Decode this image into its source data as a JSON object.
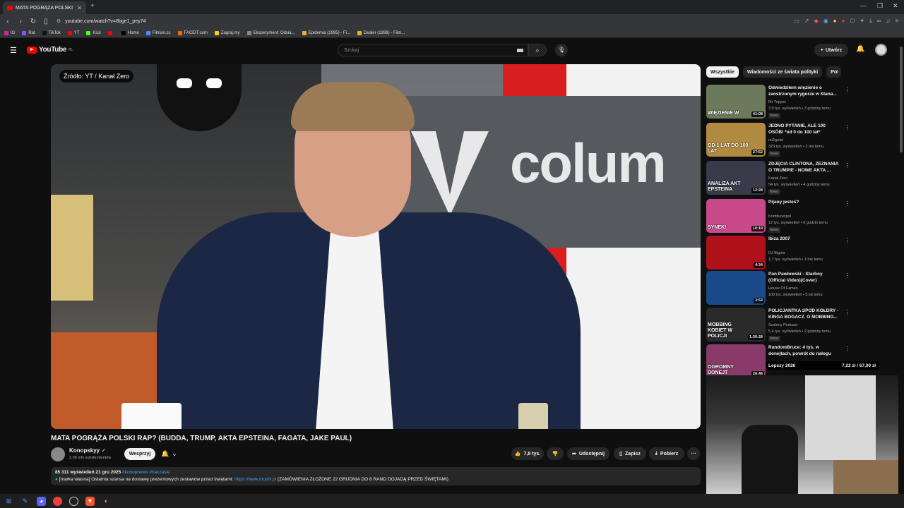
{
  "browser": {
    "tab_title": "MATA POGRĄŻA POLSKI RAP? (",
    "url": "youtube.com/watch?v=8bge1_pey74",
    "bookmarks": [
      "IG",
      "Rat",
      "TikTok",
      "YT",
      "Kick",
      "",
      "Home",
      "Filman.cc",
      "FACEIT.com",
      "Zagraj.my",
      "Eksperyment: Odsia...",
      "Epidemia (1995) - Fi...",
      "Dealer (1996) - Film..."
    ]
  },
  "header": {
    "logo": "YouTube",
    "logo_country": "PL",
    "search_placeholder": "Szukaj",
    "create_label": "Utwórz"
  },
  "video": {
    "source_badge": "Źródło: YT / Kanał Zero",
    "brand_text": "colum",
    "title": "MATA POGRĄŻA POLSKI RAP? (BUDDA, TRUMP, AKTA EPSTEINA, FAGATA, JAKE PAUL)",
    "channel": "Konopskyy",
    "subscribers": "2,08 mln subskrybentów",
    "support_label": "Wesprzyj",
    "likes": "7,8 tys.",
    "share_label": "Udostępnij",
    "save_label": "Zapisz",
    "download_label": "Pobierz",
    "views_date": "85 311 wyświetleń  21 gru 2025",
    "hashtags": "#konopnews #naczasie",
    "desc_prefix": "[marka własna] Ostatnia szansa na dostawę prezentowych zestawów przed świętami: ",
    "desc_link": "https://www.mushi.pl",
    "desc_suffix": " (ZAMÓWIENIA ZŁOŻONE 22 GRUDNIA DO 8 RANO DOJADĄ PRZED ŚWIĘTAMI)"
  },
  "chips": [
    "Wszystkie",
    "Wiadomości ze świata polityki",
    "Po"
  ],
  "recommendations": [
    {
      "title": "Odwiedziłem więzienie o zaostrzonym rygorze w Stana...",
      "channel": "Mr Tripper",
      "meta": "3,9 tys. wyświetleń • 3 godziny temu",
      "new": "Nowy",
      "duration": "41:08",
      "thumb_text": "WIĘZIENIE W",
      "color": "#6b7a5a"
    },
    {
      "title": "JEDNO PYTANIE, ALE 100 OSÓB! *od 0 do 100 lat*",
      "channel": "reZiguist",
      "meta": "323 tys. wyświetleń • 3 dni temu",
      "new": "Nowy",
      "duration": "27:52",
      "thumb_text": "OD 1 LAT DO 100 LAT",
      "color": "#b08a40"
    },
    {
      "title": "ZDJĘCIA CLINTONA, ZEZNANIA O TRUMPIE - NOWE AKTA ...",
      "channel": "Kanał Zero",
      "meta": "54 tys. wyświetleń • 4 godziny temu",
      "new": "Nowy",
      "duration": "12:28",
      "thumb_text": "ANALIZA AKT EPSTEINA",
      "color": "#3a3a4a"
    },
    {
      "title": "Pijany jesteś?",
      "channel": "Konfiturexpol",
      "meta": "12 tys. wyświetleń • 6 godzin temu",
      "new": "Nowy",
      "duration": "10:19",
      "thumb_text": "SYNEK!",
      "color": "#c84a8a"
    },
    {
      "title": "Ibiza 2007",
      "channel": "DJ Bigola",
      "meta": "1,7 tys. wyświetleń • 1 rok temu",
      "new": "",
      "duration": "4:34",
      "thumb_text": "",
      "color": "#b0101a"
    },
    {
      "title": "Pan Pawłowski - Starboy (Official Video)(Cover)",
      "channel": "House Of Fames",
      "meta": "103 tys. wyświetleń • 5 lat temu",
      "new": "",
      "duration": "3:53",
      "thumb_text": "",
      "color": "#1a4a8a"
    },
    {
      "title": "POLICJANTKA SPOD KOŁDRY - KINGA BOGACZ. O MOBBING...",
      "channel": "Szalony Podcast",
      "meta": "5,4 tys. wyświetleń • 2 godziny temu",
      "new": "Nowy",
      "duration": "1:30:28",
      "thumb_text": "MOBBING KOBIET W POLICJI",
      "color": "#2a2a2a"
    },
    {
      "title": "RandomBruce: 4 tys. w donejtach, powrót do nałogu",
      "channel": "",
      "meta": "",
      "new": "",
      "duration": "26:46",
      "thumb_text": "OGROMNY DONEJT",
      "color": "#8a3a6a"
    }
  ],
  "stream_overlay": {
    "left": "Lepszy 2026",
    "right": "7,22 zł / 67,00 zł"
  },
  "colors": {
    "accent_red": "#ff0000",
    "link_blue": "#3ea6ff",
    "background": "#0f0f0f"
  }
}
